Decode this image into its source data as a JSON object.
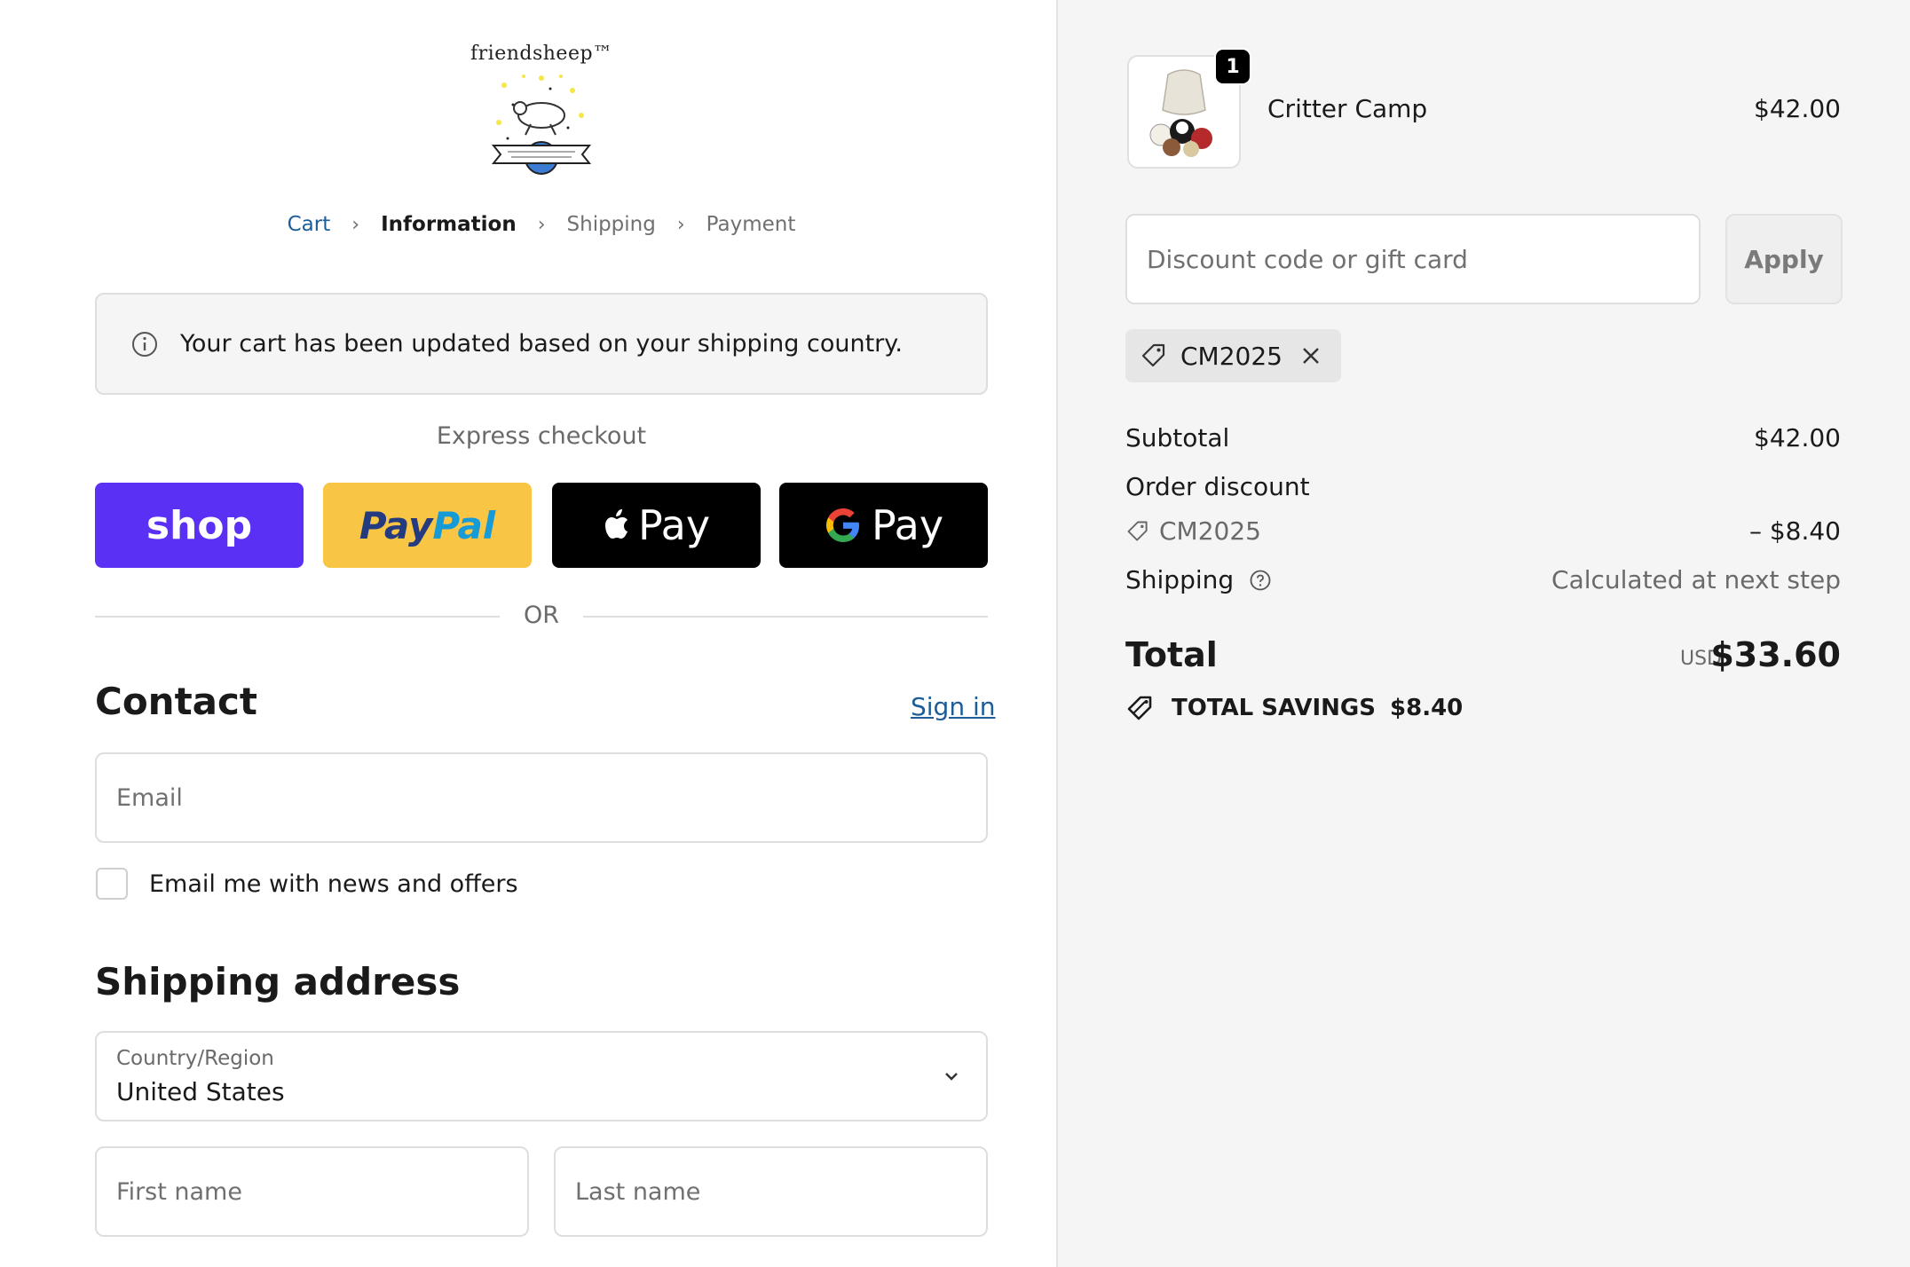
{
  "brand": {
    "logo_text": "friendsheep™"
  },
  "breadcrumb": {
    "items": [
      "Cart",
      "Information",
      "Shipping",
      "Payment"
    ]
  },
  "notice": {
    "text": "Your cart has been updated based on your shipping country."
  },
  "express": {
    "label": "Express checkout",
    "buttons": {
      "shop": "shop",
      "paypal_a": "Pay",
      "paypal_b": "Pal",
      "apple": "Pay",
      "google": "Pay"
    },
    "or": "OR"
  },
  "contact": {
    "title": "Contact",
    "sign_in": "Sign in",
    "email_placeholder": "Email",
    "newsletter_label": "Email me with news and offers"
  },
  "shipping_address": {
    "title": "Shipping address",
    "country_label": "Country/Region",
    "country_value": "United States",
    "first_name_placeholder": "First name",
    "last_name_placeholder": "Last name"
  },
  "order": {
    "item": {
      "name": "Critter Camp",
      "price": "$42.00",
      "quantity": "1"
    },
    "discount_placeholder": "Discount code or gift card",
    "apply_label": "Apply",
    "applied_code": "CM2025",
    "subtotal_label": "Subtotal",
    "subtotal_value": "$42.00",
    "order_discount_label": "Order discount",
    "order_discount_code": "CM2025",
    "order_discount_value": "– $8.40",
    "shipping_label": "Shipping",
    "shipping_value": "Calculated at next step",
    "total_label": "Total",
    "total_currency": "USD",
    "total_value": "$33.60",
    "savings_label": "TOTAL SAVINGS",
    "savings_value": "$8.40"
  },
  "colors": {
    "shop_purple": "#5a31f4",
    "paypal_yellow": "#f8c545",
    "link_blue": "#1d5d99",
    "panel_gray": "#f5f5f5"
  }
}
